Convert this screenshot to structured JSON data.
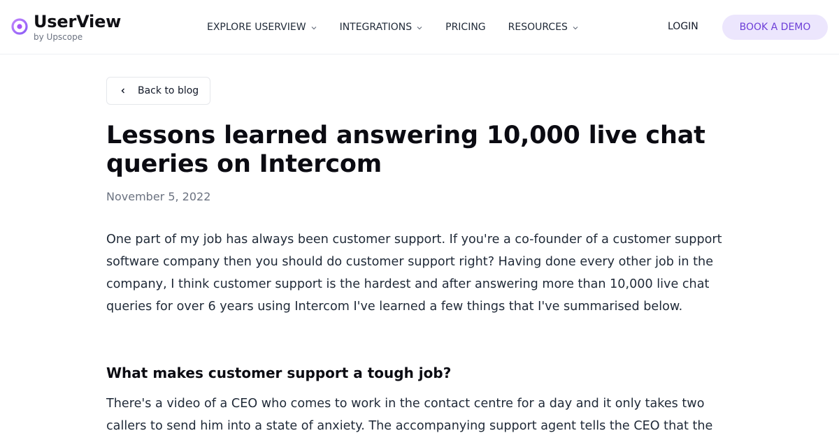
{
  "header": {
    "logo_name": "UserView",
    "logo_sub": "by Upscope",
    "nav": [
      {
        "label": "EXPLORE USERVIEW",
        "has_dropdown": true
      },
      {
        "label": "INTEGRATIONS",
        "has_dropdown": true
      },
      {
        "label": "PRICING",
        "has_dropdown": false
      },
      {
        "label": "RESOURCES",
        "has_dropdown": true
      }
    ],
    "login_label": "LOGIN",
    "demo_label": "BOOK A DEMO",
    "accent_color": "#6d3fd8",
    "demo_bg_color": "#ece6fd"
  },
  "article": {
    "back_label": "Back to blog",
    "title": "Lessons learned answering 10,000 live chat queries on Intercom",
    "date": "November 5, 2022",
    "intro": "One part of my job has always been customer support. If you're a co-founder of a customer support software company then you should do customer support right? Having done every other job in the company, I think customer support is the hardest and after answering more than 10,000 live chat queries for over 6 years using Intercom I've learned a few things that I've summarised below.",
    "heading": "What makes customer support a tough job?",
    "para2": "There's a video of a CEO who comes to work in the contact centre for a day and it only takes two callers to send him into a state of anxiety. The accompanying support agent tells the CEO that the"
  }
}
